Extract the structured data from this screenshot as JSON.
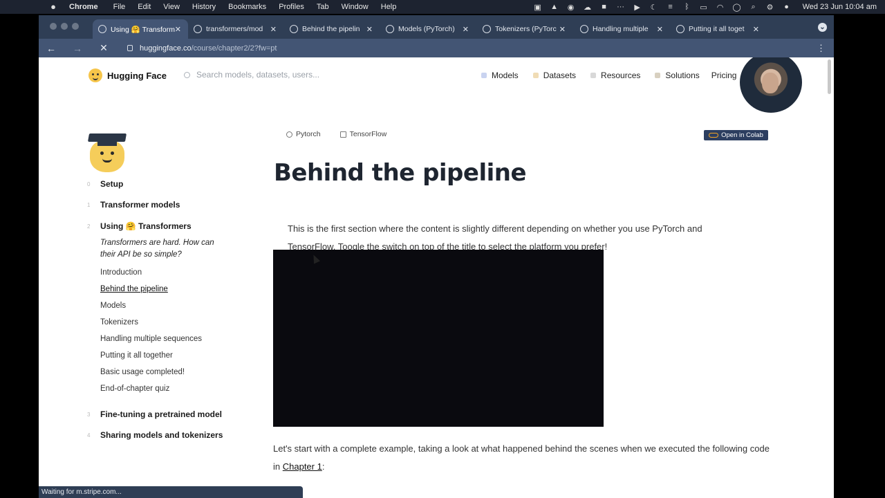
{
  "menubar": {
    "app": "Chrome",
    "items": [
      "File",
      "Edit",
      "View",
      "History",
      "Bookmarks",
      "Profiles",
      "Tab",
      "Window",
      "Help"
    ],
    "clock": "Wed 23 Jun  10:04 am"
  },
  "tabs": [
    {
      "label": "Using 🤗 Transform"
    },
    {
      "label": "transformers/mod"
    },
    {
      "label": "Behind the pipelin"
    },
    {
      "label": "Models (PyTorch)"
    },
    {
      "label": "Tokenizers (PyTorc"
    },
    {
      "label": "Handling multiple"
    },
    {
      "label": "Putting it all toget"
    }
  ],
  "address": {
    "host": "huggingface.co",
    "path": "/course/chapter2/2?fw=pt"
  },
  "hf": {
    "logo": "Hugging Face",
    "search_placeholder": "Search models, datasets, users...",
    "nav": {
      "models": "Models",
      "datasets": "Datasets",
      "resources": "Resources",
      "solutions": "Solutions",
      "pricing": "Pricing"
    }
  },
  "sidebar": {
    "sections": [
      {
        "num": "0",
        "label": "Setup"
      },
      {
        "num": "1",
        "label": "Transformer models"
      },
      {
        "num": "2",
        "label": "Using 🤗 Transformers"
      },
      {
        "num": "3",
        "label": "Fine-tuning a pretrained model"
      },
      {
        "num": "4",
        "label": "Sharing models and tokenizers"
      }
    ],
    "tagline": "Transformers are hard. How can their API be so simple?",
    "chapter_items": [
      {
        "label": "Introduction"
      },
      {
        "label": "Behind the pipeline"
      },
      {
        "label": "Models"
      },
      {
        "label": "Tokenizers"
      },
      {
        "label": "Handling multiple sequences"
      },
      {
        "label": "Putting it all together"
      },
      {
        "label": "Basic usage completed!"
      },
      {
        "label": "End-of-chapter quiz"
      }
    ]
  },
  "main": {
    "fw_pytorch": "Pytorch",
    "fw_tensorflow": "TensorFlow",
    "colab": "Open in Colab",
    "title": "Behind the pipeline",
    "intro": "This is the first section where the content is slightly different depending on whether you use PyTorch and TensorFlow. Toogle the switch on top of the title to select the platform you prefer!",
    "para2_before": "Let's start with a complete example, taking a look at what happened behind the scenes when we executed the following code in ",
    "para2_link": "Chapter 1",
    "para2_after": ":"
  },
  "status": "Waiting for m.stripe.com..."
}
